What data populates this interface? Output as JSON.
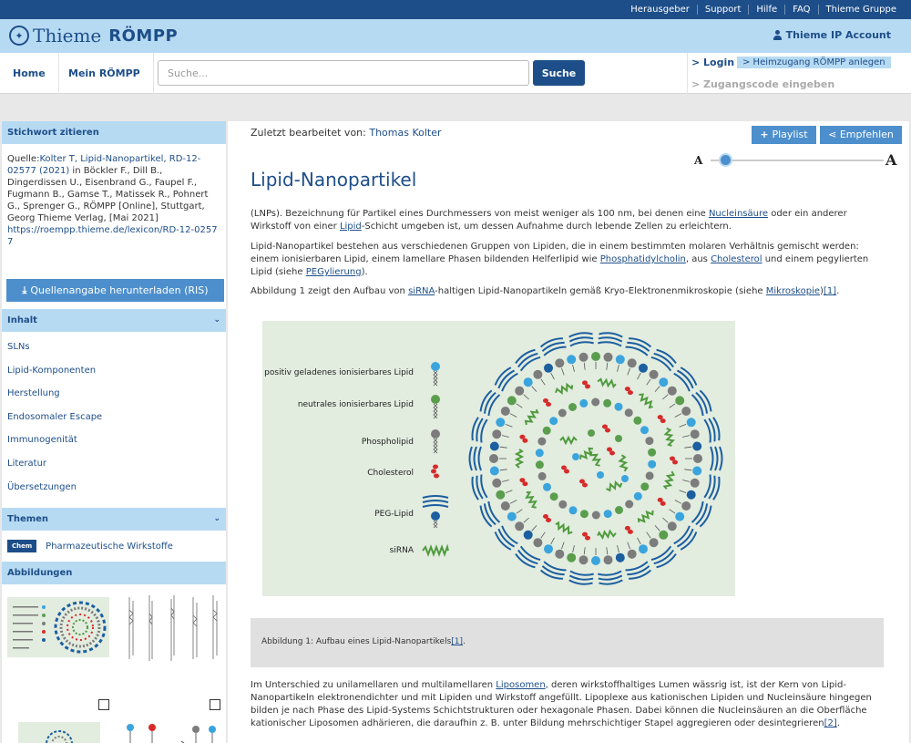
{
  "top_nav": [
    "Herausgeber",
    "Support",
    "Hilfe",
    "FAQ",
    "Thieme Gruppe"
  ],
  "brand": {
    "thieme": "Thieme",
    "roempp": "RÖMPP"
  },
  "account_label": "Thieme IP Account",
  "nav": {
    "home": "Home",
    "mein": "Mein RÖMPP"
  },
  "search": {
    "placeholder": "Suche...",
    "button": "Suche"
  },
  "login": {
    "login": "> Login",
    "heimzugang": "> Heimzugang RÖMPP anlegen",
    "zugangscode": "> Zugangscode eingeben"
  },
  "sidebar": {
    "cite_head": "Stichwort zitieren",
    "cite_prefix": "Quelle:",
    "cite_link": "Kolter T, Lipid-Nanopartikel, RD-12-02577 (2021)",
    "cite_rest": " in Böckler F., Dill B., Dingerdissen U., Eisenbrand G., Faupel F., Fugmann B., Gamse T., Matissek R., Pohnert G., Sprenger G., RÖMPP [Online], Stuttgart, Georg Thieme Verlag, [Mai 2021]",
    "cite_url": "https://roempp.thieme.de/lexicon/RD-12-02577",
    "download": "Quellenangabe herunterladen (RIS)",
    "inhalt_head": "Inhalt",
    "toc": [
      "SLNs",
      "Lipid-Komponenten",
      "Herstellung",
      "Endosomaler Escape",
      "Immunogenität",
      "Literatur",
      "Übersetzungen"
    ],
    "themen_head": "Themen",
    "themen_badge": "Chem",
    "themen_label": "Pharmazeutische Wirkstoffe",
    "abb_head": "Abbildungen"
  },
  "main": {
    "edited_label": "Zuletzt bearbeitet von:",
    "edited_by": "Thomas Kolter",
    "playlist": "Playlist",
    "recommend": "Empfehlen",
    "font_small": "A",
    "font_large": "A",
    "font_level": 0.05,
    "title": "Lipid-Nanopartikel",
    "p1": {
      "a": "(LNPs). Bezeichnung für Partikel eines Durchmessers von meist weniger als 100 nm, bei denen eine ",
      "l1": "Nucleinsäure",
      "b": " oder ein anderer Wirkstoff von einer ",
      "l2": "Lipid",
      "c": "-Schicht umgeben ist, um dessen Aufnahme durch lebende Zellen zu erleichtern."
    },
    "p2": {
      "a": "Lipid-Nanopartikel bestehen aus verschiedenen Gruppen von Lipiden, die in einem bestimmten molaren Verhältnis gemischt werden: einem ionisierbaren Lipid, einem lamellare Phasen bildenden Helferlipid wie ",
      "l1": "Phosphatidylcholin",
      "b": ", aus ",
      "l2": "Cholesterol",
      "c": " und einem pegylierten Lipid (siehe ",
      "l3": "PEGylierung",
      "d": ")."
    },
    "p3": {
      "a": "Abbildung 1 zeigt den Aufbau von ",
      "l1": "siRNA",
      "b": "-haltigen Lipid-Nanopartikeln gemäß Kryo-Elektronenmikroskopie (siehe ",
      "l2": "Mikroskopie",
      "c": ")",
      "l3": "[1]",
      "d": "."
    },
    "figure_labels": [
      "positiv geladenes ionisierbares Lipid",
      "neutrales ionisierbares Lipid",
      "Phospholipid",
      "Cholesterol",
      "PEG-Lipid",
      "siRNA"
    ],
    "caption": {
      "a": "Abbildung 1: Aufbau eines Lipid-Nanopartikels",
      "l": "[1]",
      "b": "."
    },
    "p4": {
      "a": "Im Unterschied zu unilamellaren und multilamellaren ",
      "l1": "Liposomen",
      "b": ", deren wirkstoffhaltiges Lumen wässrig ist, ist der Kern von Lipid-Nanopartikeln elektronendichter und mit Lipiden und Wirkstoff angefüllt. Lipoplexe aus kationischen Lipiden und Nucleinsäure hingegen bilden je nach Phase des Lipid-Systems Schichtstrukturen oder hexagonale Phasen. Dabei können die Nucleinsäuren an die Oberfläche kationischer Liposomen adhärieren, die daraufhin z. B. unter Bildung mehrschichtiger Stapel aggregieren oder desintegrieren",
      "l2": "[2]",
      "c": "."
    }
  },
  "colors": {
    "navy": "#1d4e89",
    "light_blue": "#b7daf3",
    "button_blue": "#4d8fcc",
    "figure_bg": "#e2ecdf",
    "cationic": "#3aa4dd",
    "neutral": "#5a9e4d",
    "phospho": "#7c7c7c",
    "cholesterol": "#d62b2b",
    "peg": "#1c5fa0",
    "sirna": "#4f9a3d"
  }
}
